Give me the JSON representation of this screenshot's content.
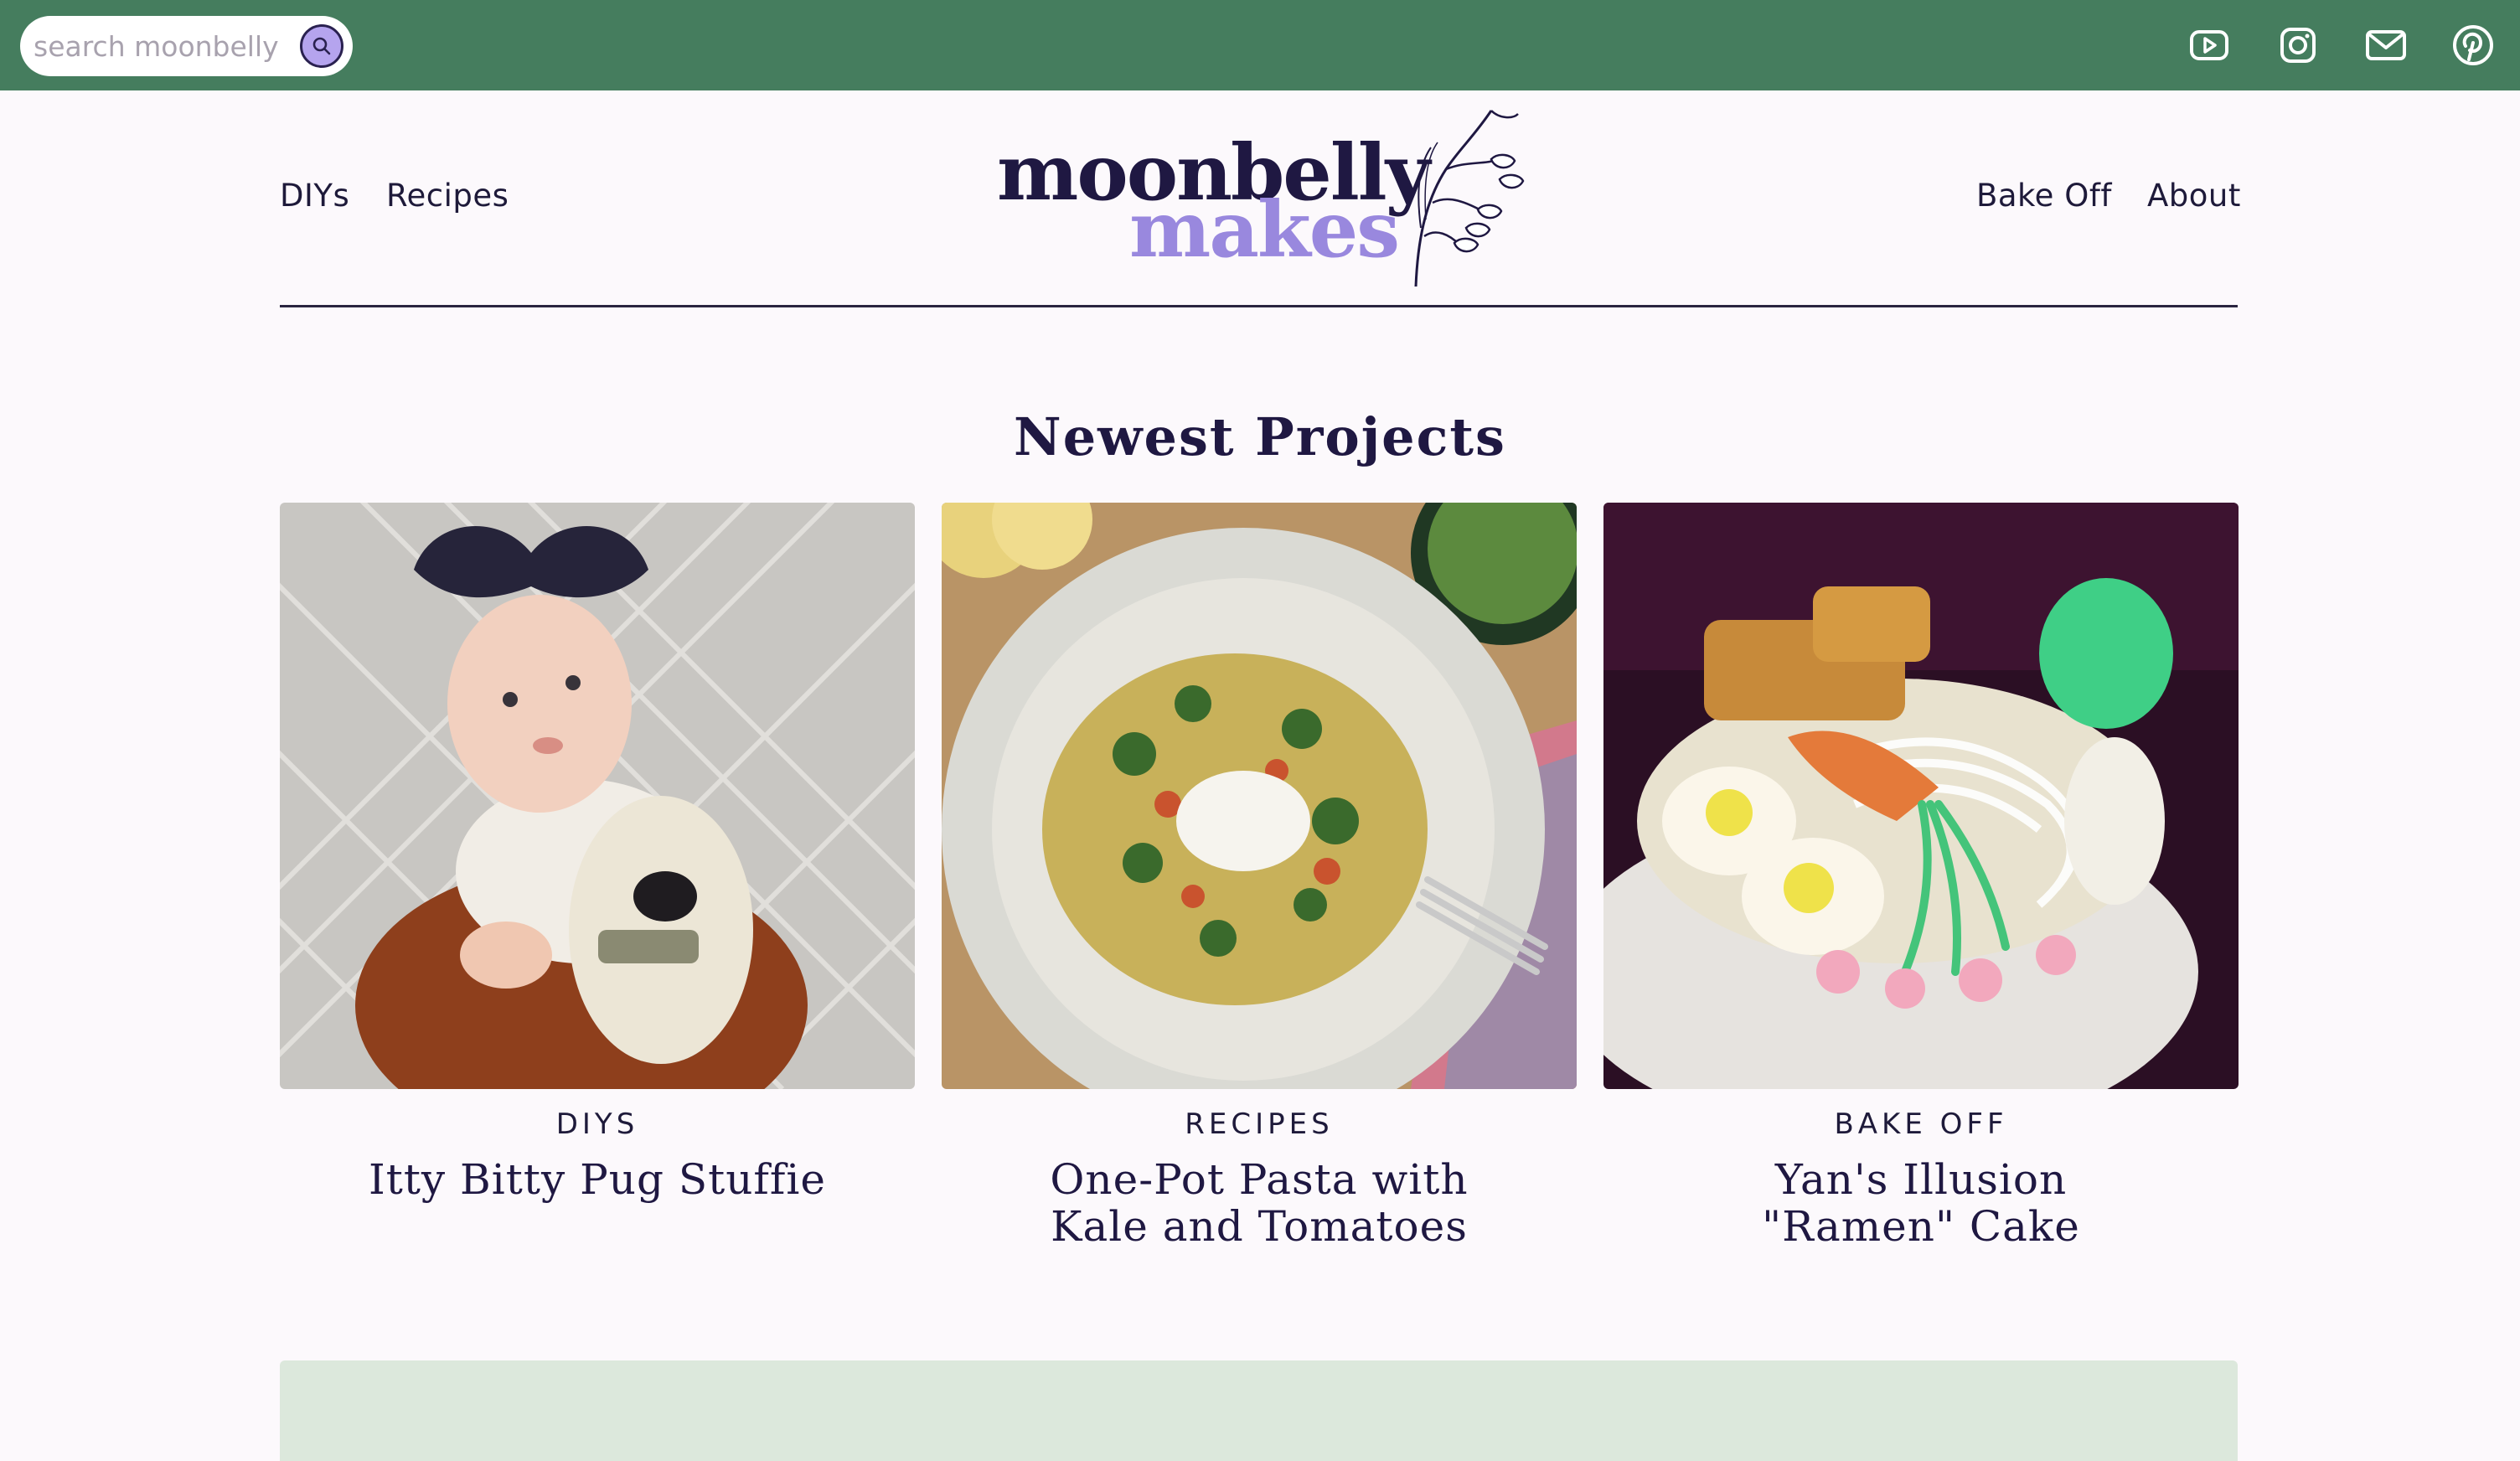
{
  "search": {
    "placeholder": "search moonbelly"
  },
  "social": {
    "icons": [
      "youtube-icon",
      "instagram-icon",
      "mail-icon",
      "pinterest-icon"
    ]
  },
  "nav": {
    "left": [
      "DIYs",
      "Recipes"
    ],
    "right": [
      "Bake Off",
      "About"
    ]
  },
  "logo": {
    "line1": "moonbelly",
    "line2": "makes"
  },
  "section": {
    "title": "Newest Projects"
  },
  "cards": [
    {
      "category": "DIYs",
      "title": "Itty Bitty Pug Stuffie"
    },
    {
      "category": "Recipes",
      "title": "One-Pot Pasta with Kale and Tomatoes"
    },
    {
      "category": "Bake Off",
      "title": "Yan's Illusion \"Ramen\" Cake"
    }
  ],
  "colors": {
    "topbar": "#457d5e",
    "accent": "#9988de",
    "ink": "#1f1842",
    "band": "#dce8dc"
  }
}
